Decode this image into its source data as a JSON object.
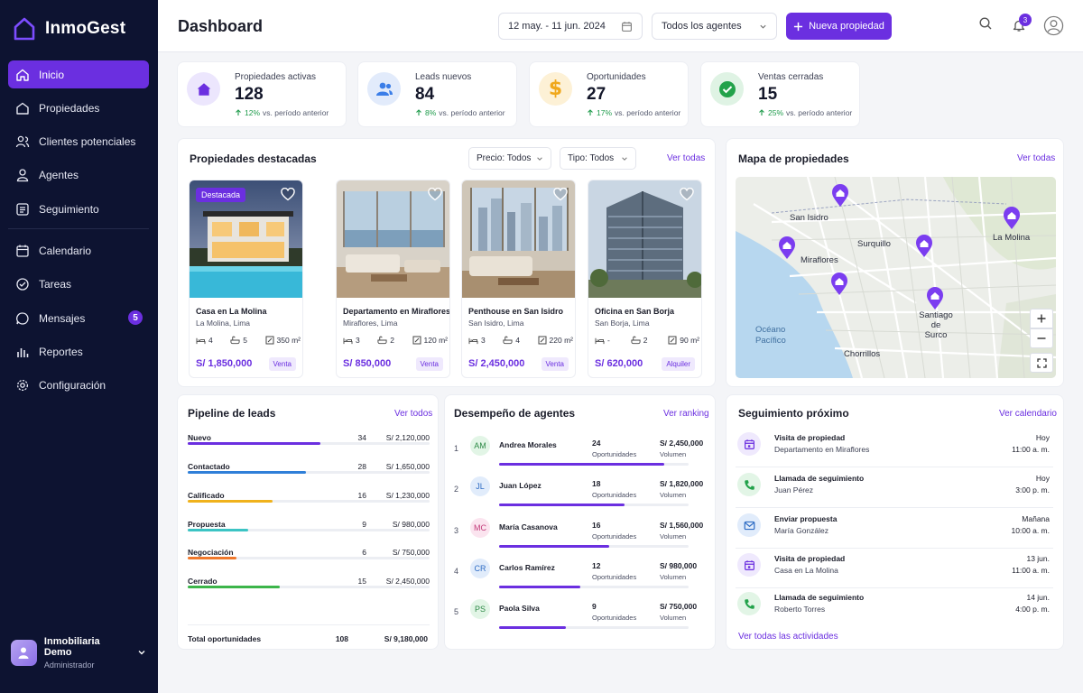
{
  "app": {
    "name": "InmoGest"
  },
  "sidebar": {
    "items": [
      {
        "label": "Inicio",
        "icon": "home-icon"
      },
      {
        "label": "Propiedades",
        "icon": "building-icon"
      },
      {
        "label": "Clientes potenciales",
        "icon": "users-icon"
      },
      {
        "label": "Agentes",
        "icon": "user-icon"
      },
      {
        "label": "Seguimiento",
        "icon": "list-icon"
      },
      {
        "label": "Calendario",
        "icon": "calendar-icon"
      },
      {
        "label": "Tareas",
        "icon": "check-circle-icon"
      },
      {
        "label": "Mensajes",
        "icon": "chat-icon",
        "badge": "5"
      },
      {
        "label": "Reportes",
        "icon": "bar-chart-icon"
      },
      {
        "label": "Configuración",
        "icon": "gear-icon"
      }
    ],
    "user": {
      "name": "Inmobiliaria Demo",
      "role": "Administrador"
    }
  },
  "header": {
    "title": "Dashboard",
    "date_range": "12 may. - 11 jun. 2024",
    "agents_filter": "Todos los agentes",
    "new_button": "Nueva propiedad",
    "notifications": "3"
  },
  "stats": [
    {
      "label": "Propiedades activas",
      "value": "128",
      "pct": "12%",
      "note": "vs. período anterior",
      "color": "#6b2fe0"
    },
    {
      "label": "Leads nuevos",
      "value": "84",
      "pct": "8%",
      "note": "vs. período anterior",
      "color": "#3b7ee8"
    },
    {
      "label": "Oportunidades",
      "value": "27",
      "pct": "17%",
      "note": "vs. período anterior",
      "color": "#f0a81c"
    },
    {
      "label": "Ventas cerradas",
      "value": "15",
      "pct": "25%",
      "note": "vs. período anterior",
      "color": "#22a24a"
    }
  ],
  "featured": {
    "title": "Propiedades destacadas",
    "price_filter": "Precio: Todos",
    "type_filter": "Tipo: Todos",
    "see_all": "Ver todas",
    "badge": "Destacada",
    "items": [
      {
        "name": "Casa en La Molina",
        "location": "La Molina, Lima",
        "beds": "4",
        "baths": "5",
        "area": "350 m²",
        "price": "S/ 1,850,000",
        "type": "Venta"
      },
      {
        "name": "Departamento en Miraflores",
        "location": "Miraflores, Lima",
        "beds": "3",
        "baths": "2",
        "area": "120 m²",
        "price": "S/ 850,000",
        "type": "Venta"
      },
      {
        "name": "Penthouse en San Isidro",
        "location": "San Isidro, Lima",
        "beds": "3",
        "baths": "4",
        "area": "220 m²",
        "price": "S/ 2,450,000",
        "type": "Venta"
      },
      {
        "name": "Oficina en San Borja",
        "location": "San Borja, Lima",
        "beds": "-",
        "baths": "2",
        "area": "90 m²",
        "price": "S/ 620,000",
        "type": "Alquiler"
      }
    ]
  },
  "map": {
    "title": "Mapa de propiedades",
    "see_all": "Ver todas",
    "labels": [
      "San Isidro",
      "Surquillo",
      "La Molina",
      "Miraflores",
      "Santiago de Surco",
      "Océano Pacífico",
      "Chorrillos"
    ]
  },
  "pipeline": {
    "title": "Pipeline de leads",
    "see_all": "Ver todos",
    "rows": [
      {
        "stage": "Nuevo",
        "count": "34",
        "amount": "S/ 2,120,000",
        "fill": 0.55,
        "color": "#6b2fe0"
      },
      {
        "stage": "Contactado",
        "count": "28",
        "amount": "S/ 1,650,000",
        "fill": 0.49,
        "color": "#2f7fd8"
      },
      {
        "stage": "Calificado",
        "count": "16",
        "amount": "S/ 1,230,000",
        "fill": 0.35,
        "color": "#f0b21c"
      },
      {
        "stage": "Propuesta",
        "count": "9",
        "amount": "S/ 980,000",
        "fill": 0.25,
        "color": "#3cc4c4"
      },
      {
        "stage": "Negociación",
        "count": "6",
        "amount": "S/ 750,000",
        "fill": 0.2,
        "color": "#f0782c"
      },
      {
        "stage": "Cerrado",
        "count": "15",
        "amount": "S/ 2,450,000",
        "fill": 0.38,
        "color": "#3cb54a"
      }
    ],
    "total_label": "Total oportunidades",
    "total_count": "108",
    "total_amount": "S/ 9,180,000"
  },
  "agents": {
    "title": "Desempeño de agentes",
    "see_all": "Ver ranking",
    "opp_label": "Oportunidades",
    "vol_label": "Volumen",
    "rows": [
      {
        "rank": "1",
        "initials": "AM",
        "name": "Andrea Morales",
        "opps": "24",
        "volume": "S/ 2,450,000",
        "fill": 0.87,
        "bg": "#e2f5e6",
        "fg": "#2e8a47"
      },
      {
        "rank": "2",
        "initials": "JL",
        "name": "Juan López",
        "opps": "18",
        "volume": "S/ 1,820,000",
        "fill": 0.66,
        "bg": "#e1ecfb",
        "fg": "#2e6cc4"
      },
      {
        "rank": "3",
        "initials": "MC",
        "name": "María Casanova",
        "opps": "16",
        "volume": "S/ 1,560,000",
        "fill": 0.58,
        "bg": "#fbe4ef",
        "fg": "#c23a7a"
      },
      {
        "rank": "4",
        "initials": "CR",
        "name": "Carlos Ramírez",
        "opps": "12",
        "volume": "S/ 980,000",
        "fill": 0.43,
        "bg": "#e1ecfb",
        "fg": "#2e6cc4"
      },
      {
        "rank": "5",
        "initials": "PS",
        "name": "Paola Silva",
        "opps": "9",
        "volume": "S/ 750,000",
        "fill": 0.35,
        "bg": "#e2f5e6",
        "fg": "#2e8a47"
      }
    ]
  },
  "followup": {
    "title": "Seguimiento próximo",
    "see_all": "Ver calendario",
    "all_link": "Ver todas las actividades",
    "items": [
      {
        "title": "Visita de propiedad",
        "subject": "Departamento en Miraflores",
        "day": "Hoy",
        "time": "11:00 a. m.",
        "icon": "calendar-icon",
        "bg": "#efe9fd",
        "fg": "#6b2fe0"
      },
      {
        "title": "Llamada de seguimiento",
        "subject": "Juan Pérez",
        "day": "Hoy",
        "time": "3:00 p. m.",
        "icon": "phone-icon",
        "bg": "#e2f5e6",
        "fg": "#22a24a"
      },
      {
        "title": "Enviar propuesta",
        "subject": "María González",
        "day": "Mañana",
        "time": "10:00 a. m.",
        "icon": "mail-icon",
        "bg": "#e1ecfb",
        "fg": "#2e6cc4"
      },
      {
        "title": "Visita de propiedad",
        "subject": "Casa en La Molina",
        "day": "13 jun.",
        "time": "11:00 a. m.",
        "icon": "calendar-icon",
        "bg": "#efe9fd",
        "fg": "#6b2fe0"
      },
      {
        "title": "Llamada de seguimiento",
        "subject": "Roberto Torres",
        "day": "14 jun.",
        "time": "4:00 p. m.",
        "icon": "phone-icon",
        "bg": "#e2f5e6",
        "fg": "#22a24a"
      }
    ]
  }
}
